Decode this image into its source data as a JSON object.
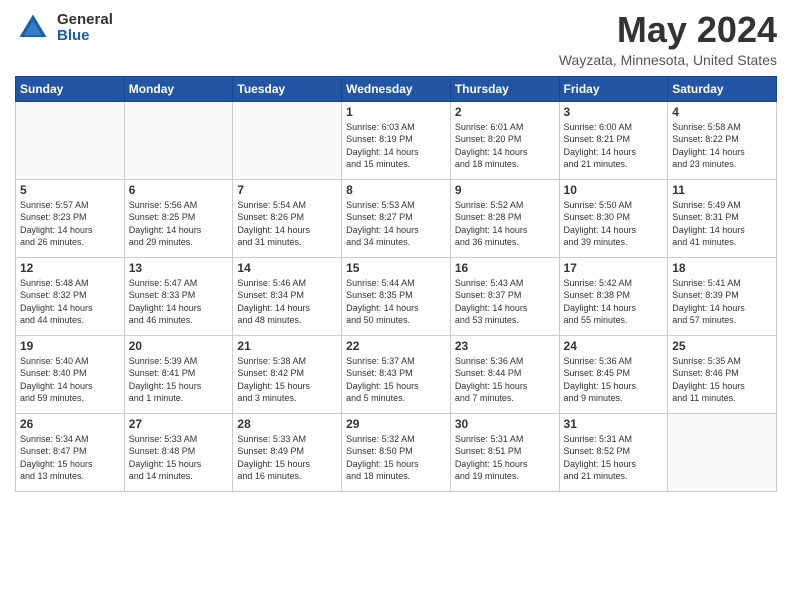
{
  "header": {
    "logo_general": "General",
    "logo_blue": "Blue",
    "title": "May 2024",
    "subtitle": "Wayzata, Minnesota, United States"
  },
  "weekdays": [
    "Sunday",
    "Monday",
    "Tuesday",
    "Wednesday",
    "Thursday",
    "Friday",
    "Saturday"
  ],
  "weeks": [
    [
      {
        "day": "",
        "info": ""
      },
      {
        "day": "",
        "info": ""
      },
      {
        "day": "",
        "info": ""
      },
      {
        "day": "1",
        "info": "Sunrise: 6:03 AM\nSunset: 8:19 PM\nDaylight: 14 hours\nand 15 minutes."
      },
      {
        "day": "2",
        "info": "Sunrise: 6:01 AM\nSunset: 8:20 PM\nDaylight: 14 hours\nand 18 minutes."
      },
      {
        "day": "3",
        "info": "Sunrise: 6:00 AM\nSunset: 8:21 PM\nDaylight: 14 hours\nand 21 minutes."
      },
      {
        "day": "4",
        "info": "Sunrise: 5:58 AM\nSunset: 8:22 PM\nDaylight: 14 hours\nand 23 minutes."
      }
    ],
    [
      {
        "day": "5",
        "info": "Sunrise: 5:57 AM\nSunset: 8:23 PM\nDaylight: 14 hours\nand 26 minutes."
      },
      {
        "day": "6",
        "info": "Sunrise: 5:56 AM\nSunset: 8:25 PM\nDaylight: 14 hours\nand 29 minutes."
      },
      {
        "day": "7",
        "info": "Sunrise: 5:54 AM\nSunset: 8:26 PM\nDaylight: 14 hours\nand 31 minutes."
      },
      {
        "day": "8",
        "info": "Sunrise: 5:53 AM\nSunset: 8:27 PM\nDaylight: 14 hours\nand 34 minutes."
      },
      {
        "day": "9",
        "info": "Sunrise: 5:52 AM\nSunset: 8:28 PM\nDaylight: 14 hours\nand 36 minutes."
      },
      {
        "day": "10",
        "info": "Sunrise: 5:50 AM\nSunset: 8:30 PM\nDaylight: 14 hours\nand 39 minutes."
      },
      {
        "day": "11",
        "info": "Sunrise: 5:49 AM\nSunset: 8:31 PM\nDaylight: 14 hours\nand 41 minutes."
      }
    ],
    [
      {
        "day": "12",
        "info": "Sunrise: 5:48 AM\nSunset: 8:32 PM\nDaylight: 14 hours\nand 44 minutes."
      },
      {
        "day": "13",
        "info": "Sunrise: 5:47 AM\nSunset: 8:33 PM\nDaylight: 14 hours\nand 46 minutes."
      },
      {
        "day": "14",
        "info": "Sunrise: 5:46 AM\nSunset: 8:34 PM\nDaylight: 14 hours\nand 48 minutes."
      },
      {
        "day": "15",
        "info": "Sunrise: 5:44 AM\nSunset: 8:35 PM\nDaylight: 14 hours\nand 50 minutes."
      },
      {
        "day": "16",
        "info": "Sunrise: 5:43 AM\nSunset: 8:37 PM\nDaylight: 14 hours\nand 53 minutes."
      },
      {
        "day": "17",
        "info": "Sunrise: 5:42 AM\nSunset: 8:38 PM\nDaylight: 14 hours\nand 55 minutes."
      },
      {
        "day": "18",
        "info": "Sunrise: 5:41 AM\nSunset: 8:39 PM\nDaylight: 14 hours\nand 57 minutes."
      }
    ],
    [
      {
        "day": "19",
        "info": "Sunrise: 5:40 AM\nSunset: 8:40 PM\nDaylight: 14 hours\nand 59 minutes."
      },
      {
        "day": "20",
        "info": "Sunrise: 5:39 AM\nSunset: 8:41 PM\nDaylight: 15 hours\nand 1 minute."
      },
      {
        "day": "21",
        "info": "Sunrise: 5:38 AM\nSunset: 8:42 PM\nDaylight: 15 hours\nand 3 minutes."
      },
      {
        "day": "22",
        "info": "Sunrise: 5:37 AM\nSunset: 8:43 PM\nDaylight: 15 hours\nand 5 minutes."
      },
      {
        "day": "23",
        "info": "Sunrise: 5:36 AM\nSunset: 8:44 PM\nDaylight: 15 hours\nand 7 minutes."
      },
      {
        "day": "24",
        "info": "Sunrise: 5:36 AM\nSunset: 8:45 PM\nDaylight: 15 hours\nand 9 minutes."
      },
      {
        "day": "25",
        "info": "Sunrise: 5:35 AM\nSunset: 8:46 PM\nDaylight: 15 hours\nand 11 minutes."
      }
    ],
    [
      {
        "day": "26",
        "info": "Sunrise: 5:34 AM\nSunset: 8:47 PM\nDaylight: 15 hours\nand 13 minutes."
      },
      {
        "day": "27",
        "info": "Sunrise: 5:33 AM\nSunset: 8:48 PM\nDaylight: 15 hours\nand 14 minutes."
      },
      {
        "day": "28",
        "info": "Sunrise: 5:33 AM\nSunset: 8:49 PM\nDaylight: 15 hours\nand 16 minutes."
      },
      {
        "day": "29",
        "info": "Sunrise: 5:32 AM\nSunset: 8:50 PM\nDaylight: 15 hours\nand 18 minutes."
      },
      {
        "day": "30",
        "info": "Sunrise: 5:31 AM\nSunset: 8:51 PM\nDaylight: 15 hours\nand 19 minutes."
      },
      {
        "day": "31",
        "info": "Sunrise: 5:31 AM\nSunset: 8:52 PM\nDaylight: 15 hours\nand 21 minutes."
      },
      {
        "day": "",
        "info": ""
      }
    ]
  ]
}
